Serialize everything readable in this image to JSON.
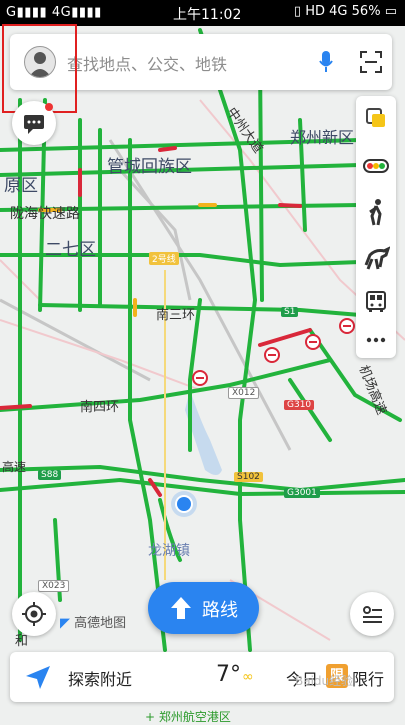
{
  "status_bar": {
    "signal": "G",
    "network": "4G",
    "time": "上午11:02",
    "indicators": "HD",
    "network2": "4G",
    "battery": "56%"
  },
  "search": {
    "placeholder": "查找地点、公交、地铁"
  },
  "map_labels": {
    "guancheng": "管城回族区",
    "zhengzhou_new": "郑州新区",
    "yuanqu": "原区",
    "longhai": "陇海快速路",
    "erqi": "二七区",
    "nansanhuan": "南三环",
    "nansihuan": "南四环",
    "zhonzhou": "中州大道",
    "airport": "机场高速",
    "gaosu": "高速",
    "longhu": "龙湖镇",
    "he": "和"
  },
  "road_shields": {
    "line2": "2号线",
    "s1": "S1",
    "x012": "X012",
    "g310": "G310",
    "s88": "S88",
    "s102": "S102",
    "g3001": "G3001",
    "x023": "X023"
  },
  "buttons": {
    "route": "路线"
  },
  "logo": "高德地图",
  "bottom_bar": {
    "explore": "探索附近",
    "temperature": "7°",
    "limit_prefix": "今日",
    "limit_badge": "限",
    "limit_suffix": "限行"
  },
  "watermark": "Baidu经验",
  "bottom_text": "+ 郑州航空港区",
  "colors": {
    "road_green": "#22b33c",
    "accent_blue": "#2a84f0",
    "traffic_red": "#d9283a",
    "traffic_yellow": "#f2b31c",
    "highlight_box": "#e02020"
  }
}
